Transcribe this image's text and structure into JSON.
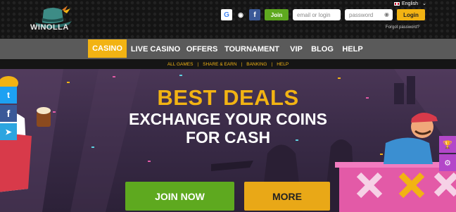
{
  "header": {
    "logo_text": "WINOLLA",
    "language": "English",
    "social_google": "G",
    "social_steam": "◉",
    "social_facebook": "f",
    "join_label": "Join",
    "email_placeholder": "email or login",
    "password_placeholder": "password",
    "login_label": "Login",
    "forgot_label": "Forgot password?"
  },
  "nav": {
    "items": [
      {
        "label": "CASINO"
      },
      {
        "label": "LIVE CASINO"
      },
      {
        "label": "OFFERS"
      },
      {
        "label": "TOURNAMENT"
      },
      {
        "label": "VIP"
      },
      {
        "label": "BLOG"
      },
      {
        "label": "HELP"
      }
    ]
  },
  "subnav": {
    "items": [
      {
        "label": "ALL GAMES"
      },
      {
        "label": "SHARE & EARN"
      },
      {
        "label": "BANKING"
      },
      {
        "label": "HELP"
      }
    ]
  },
  "hero": {
    "title": "BEST DEALS",
    "subtitle_line1": "EXCHANGE YOUR COINS",
    "subtitle_line2": "FOR CASH",
    "join_button": "JOIN NOW",
    "more_button": "MORE"
  },
  "colors": {
    "accent_yellow": "#f2b313",
    "green": "#5ea91f",
    "nav_gray": "#5a5a5a",
    "purple_side": "#b347c9"
  }
}
